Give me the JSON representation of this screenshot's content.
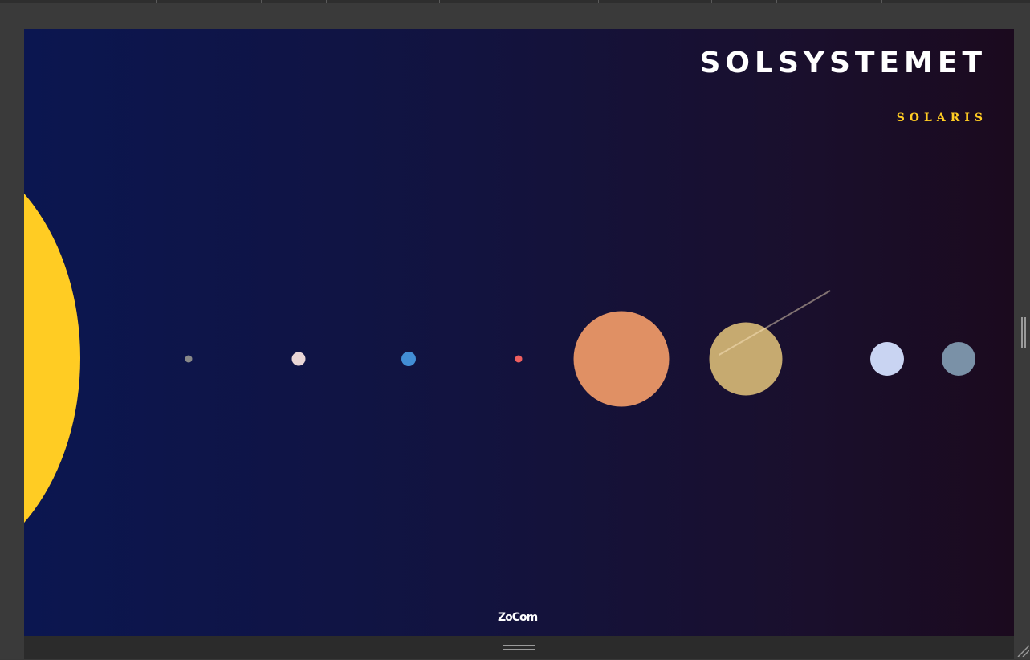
{
  "page": {
    "title": "SOLSYSTEMET",
    "subtitle": "SOLARIS",
    "logo_text": "ZoCom"
  },
  "colors": {
    "sun": "#ffcc23",
    "title": "#ffffff",
    "subtitle": "#ffcc23",
    "background_left": "#0b1650",
    "background_right": "#1b0a1e"
  },
  "planets": [
    {
      "id": "planet-1",
      "color": "#888888"
    },
    {
      "id": "planet-2",
      "color": "#e9d6d6"
    },
    {
      "id": "planet-3",
      "color": "#428ed5"
    },
    {
      "id": "planet-4",
      "color": "#ef5f5f"
    },
    {
      "id": "planet-5",
      "color": "#e09064"
    },
    {
      "id": "planet-6",
      "color": "#c6aa70",
      "ring": true
    },
    {
      "id": "planet-7",
      "color": "#c9d4f2"
    },
    {
      "id": "planet-8",
      "color": "#7a91a7"
    }
  ],
  "icons": {
    "bottom_handle": "drag-handle-icon",
    "side_handle": "drag-handle-icon",
    "corner_handle": "resize-corner-icon"
  }
}
